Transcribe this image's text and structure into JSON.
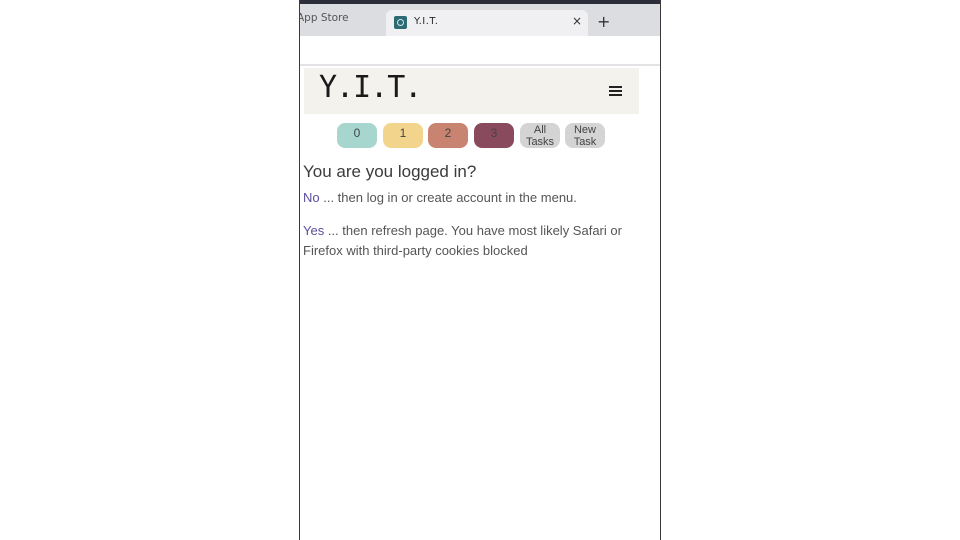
{
  "browser": {
    "prev_tab_label": "App Store",
    "active_tab_title": "Y.I.T.",
    "close_icon": "×",
    "new_tab_icon": "+"
  },
  "site": {
    "logo_text": "Y.I.T.",
    "menu_icon": "hamburger-icon"
  },
  "filters": [
    {
      "label": "0",
      "color": "#a6d6cd"
    },
    {
      "label": "1",
      "color": "#f3d48c"
    },
    {
      "label": "2",
      "color": "#c98371"
    },
    {
      "label": "3",
      "color": "#8a4a5e"
    },
    {
      "line1": "All",
      "line2": "Tasks",
      "color": "#d4d4d4"
    },
    {
      "line1": "New",
      "line2": "Task",
      "color": "#d4d4d4"
    }
  ],
  "main": {
    "question": "You are you logged in?",
    "no_link": "No",
    "no_text": " ... then log in or create account in the menu.",
    "yes_link": "Yes",
    "yes_text": " ... then refresh page. You have most likely Safari or Firefox with third-party cookies blocked"
  }
}
